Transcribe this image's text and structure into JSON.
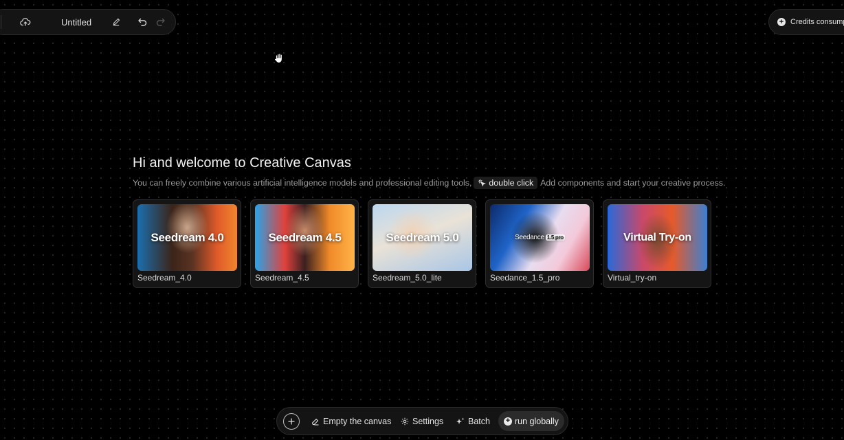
{
  "topbar": {
    "title": "Untitled",
    "icons": [
      "cloud-upload-icon",
      "edit-icon",
      "undo-icon",
      "redo-icon"
    ]
  },
  "credits": {
    "label": "Credits consumption"
  },
  "welcome": {
    "title": "Hi and welcome to Creative Canvas",
    "subtitle_before": "You can freely combine various artificial intelligence models and professional editing tools,",
    "chip": "double click",
    "subtitle_after": "Add components and start your creative process."
  },
  "cards": [
    {
      "label": "Seedream_4.0",
      "overlay": "Seedream 4.0"
    },
    {
      "label": "Seedream_4.5",
      "overlay": "Seedream 4.5"
    },
    {
      "label": "Seedream_5.0_lite",
      "overlay": "Seedream 5.0"
    },
    {
      "label": "Seedance_1.5_pro",
      "overlay": "Seedance",
      "overlay_tag": "1.5 pro"
    },
    {
      "label": "Virtual_try-on",
      "overlay": "Virtual Try-on"
    }
  ],
  "bottombar": {
    "empty": "Empty the canvas",
    "settings": "Settings",
    "batch": "Batch",
    "run": "run globally"
  },
  "colors": {
    "background": "#000000",
    "panel": "#141414",
    "text": "#e6e6e6",
    "muted": "#9a9a9a"
  }
}
